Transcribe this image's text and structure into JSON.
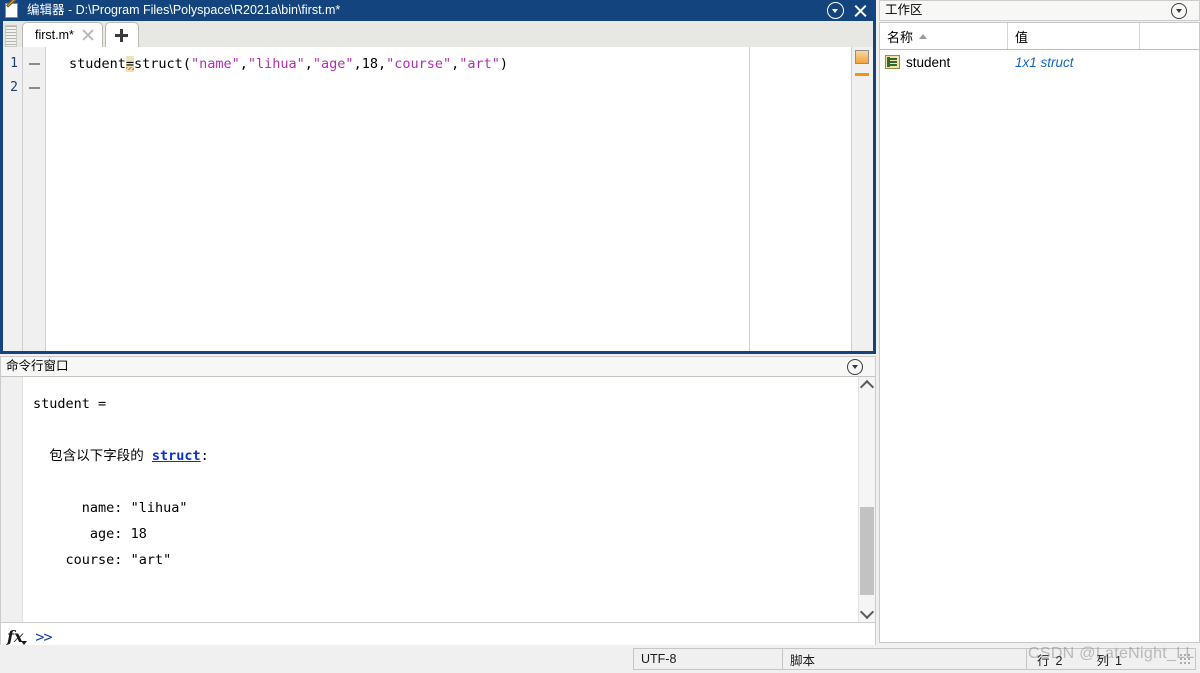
{
  "editor": {
    "title": "编辑器 - D:\\Program Files\\Polyspace\\R2021a\\bin\\first.m*",
    "app_icon": "matlab-editor-icon",
    "titlebar_dropdown_icon": "chevron-down-circle-icon",
    "titlebar_close_icon": "close-icon",
    "tabs": [
      {
        "label": "first.m*",
        "close_icon": "close-icon"
      }
    ],
    "new_tab_icon": "plus-icon",
    "lines": [
      {
        "number": "1",
        "marker": "—"
      },
      {
        "number": "2",
        "marker": "—"
      }
    ],
    "code": {
      "segments": [
        {
          "text": "student",
          "type": "plain"
        },
        {
          "text": "=",
          "type": "highlight"
        },
        {
          "text": "struct(",
          "type": "plain"
        },
        {
          "text": "\"name\"",
          "type": "string"
        },
        {
          "text": ",",
          "type": "plain"
        },
        {
          "text": "\"lihua\"",
          "type": "string"
        },
        {
          "text": ",",
          "type": "plain"
        },
        {
          "text": "\"age\"",
          "type": "string"
        },
        {
          "text": ",",
          "type": "plain"
        },
        {
          "text": "18",
          "type": "number"
        },
        {
          "text": ",",
          "type": "plain"
        },
        {
          "text": "\"course\"",
          "type": "string"
        },
        {
          "text": ",",
          "type": "plain"
        },
        {
          "text": "\"art\"",
          "type": "string"
        },
        {
          "text": ")",
          "type": "plain"
        }
      ]
    },
    "analyzer": {
      "status_icon": "code-analyzer-warning-icon",
      "marker_icon": "warning-marker-icon"
    }
  },
  "command_window": {
    "title": "命令行窗口",
    "header_dropdown_icon": "chevron-down-circle-icon",
    "output": {
      "variable_line": "student =",
      "struct_prefix": "  包含以下字段的 ",
      "struct_link": "struct",
      "struct_suffix": ":",
      "fields": [
        {
          "name": "name",
          "value": "\"lihua\""
        },
        {
          "name": "age",
          "value": "18"
        },
        {
          "name": "course",
          "value": "\"art\""
        }
      ]
    },
    "scrollbar": {
      "up_icon": "chevron-up-icon",
      "down_icon": "chevron-down-icon"
    },
    "prompt": {
      "fx_icon": "fx-function-icon",
      "prompt_symbol": ">>"
    }
  },
  "workspace": {
    "title": "工作区",
    "header_dropdown_icon": "chevron-down-circle-icon",
    "columns": [
      {
        "label": "名称",
        "sort": "asc"
      },
      {
        "label": "值",
        "sort": "none"
      },
      {
        "label": "",
        "sort": "none"
      }
    ],
    "rows": [
      {
        "icon": "struct-variable-icon",
        "name": "student",
        "value": "1x1 struct"
      }
    ]
  },
  "status_bar": {
    "encoding": "UTF-8",
    "file_type": "脚本",
    "row_label": "行",
    "row_value": "2",
    "col_label": "列",
    "col_value": "1",
    "resize_grip_icon": "resize-grip-icon"
  },
  "watermark": {
    "text": "CSDN @LateNight_LL"
  },
  "colors": {
    "titlebar_blue": "#14447d",
    "string_magenta": "#b02fb0",
    "link_blue": "#0b33c9",
    "workspace_value_blue": "#1565c0",
    "analyzer_orange": "#f39313"
  }
}
